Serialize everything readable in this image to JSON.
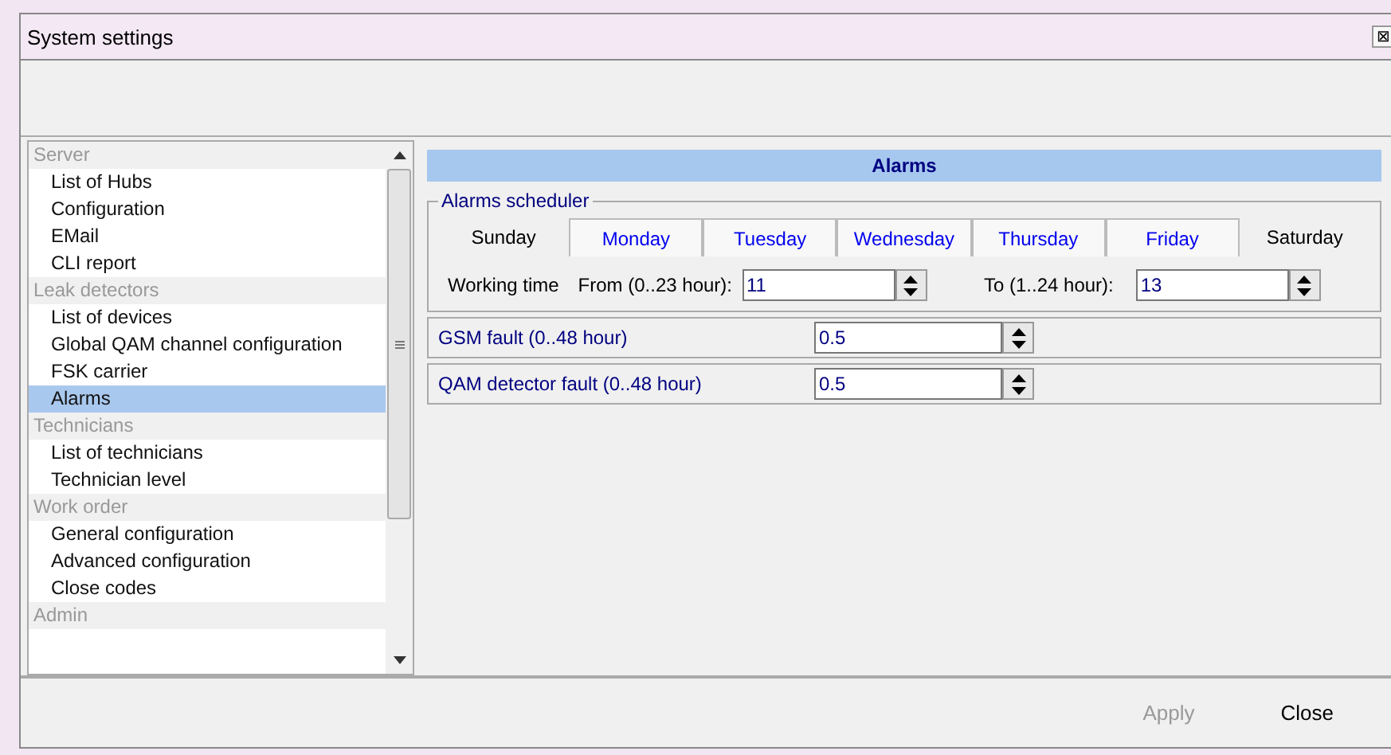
{
  "window": {
    "title": "System settings",
    "close_label": "⊠"
  },
  "sidebar": {
    "groups": [
      {
        "label": "Server",
        "items": [
          {
            "label": "List of Hubs",
            "selected": false
          },
          {
            "label": "Configuration",
            "selected": false
          },
          {
            "label": "EMail",
            "selected": false
          },
          {
            "label": "CLI report",
            "selected": false
          }
        ]
      },
      {
        "label": "Leak detectors",
        "items": [
          {
            "label": "List of devices",
            "selected": false
          },
          {
            "label": "Global QAM channel configuration",
            "selected": false
          },
          {
            "label": "FSK carrier",
            "selected": false
          },
          {
            "label": "Alarms",
            "selected": true
          }
        ]
      },
      {
        "label": "Technicians",
        "items": [
          {
            "label": "List of technicians",
            "selected": false
          },
          {
            "label": "Technician level",
            "selected": false
          }
        ]
      },
      {
        "label": "Work order",
        "items": [
          {
            "label": "General configuration",
            "selected": false
          },
          {
            "label": "Advanced configuration",
            "selected": false
          },
          {
            "label": "Close codes",
            "selected": false
          }
        ]
      },
      {
        "label": "Admin"
      }
    ]
  },
  "panel": {
    "title": "Alarms",
    "scheduler": {
      "title": "Alarms scheduler",
      "days": [
        {
          "label": "Sunday",
          "on": false
        },
        {
          "label": "Monday",
          "on": true
        },
        {
          "label": "Tuesday",
          "on": true
        },
        {
          "label": "Wednesday",
          "on": true
        },
        {
          "label": "Thursday",
          "on": true
        },
        {
          "label": "Friday",
          "on": true
        },
        {
          "label": "Saturday",
          "on": false
        }
      ],
      "working_time_label": "Working time",
      "from_label": "From (0..23 hour):",
      "from_value": "11",
      "to_label": "To (1..24 hour):",
      "to_value": "13"
    },
    "fields": [
      {
        "label": "GSM fault (0..48 hour)",
        "value": "0.5"
      },
      {
        "label": "QAM detector fault (0..48 hour)",
        "value": "0.5"
      }
    ]
  },
  "buttons": [
    {
      "label": "Apply",
      "disabled": true
    },
    {
      "label": "Close",
      "disabled": false
    }
  ]
}
